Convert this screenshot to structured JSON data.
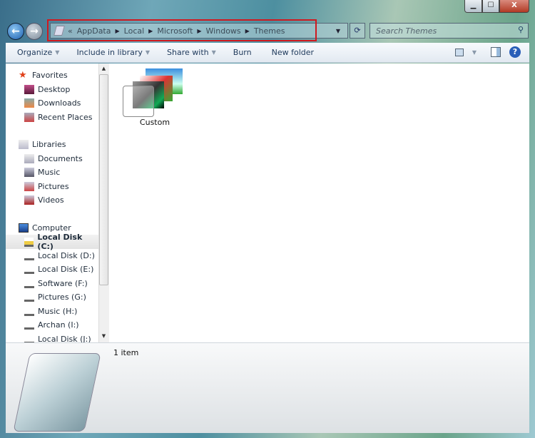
{
  "window": {
    "minimize": "▁",
    "maximize": "☐",
    "close": "X"
  },
  "nav": {
    "back": "←",
    "forward": "→"
  },
  "address": {
    "prefix": "«",
    "crumbs": [
      "AppData",
      "Local",
      "Microsoft",
      "Windows",
      "Themes"
    ]
  },
  "search": {
    "placeholder": "Search Themes",
    "icon": "search-icon"
  },
  "toolbar": {
    "organize": "Organize",
    "include": "Include in library",
    "share": "Share with",
    "burn": "Burn",
    "new_folder": "New folder",
    "help": "?"
  },
  "sidebar": {
    "favorites": {
      "label": "Favorites",
      "items": [
        "Desktop",
        "Downloads",
        "Recent Places"
      ]
    },
    "libraries": {
      "label": "Libraries",
      "items": [
        "Documents",
        "Music",
        "Pictures",
        "Videos"
      ]
    },
    "computer": {
      "label": "Computer",
      "items": [
        "Local Disk (C:)",
        "Local Disk (D:)",
        "Local Disk (E:)",
        "Software (F:)",
        "Pictures (G:)",
        "Music (H:)",
        "Archan (I:)",
        "Local Disk (J:)"
      ],
      "selected": "Local Disk (C:)"
    }
  },
  "content": {
    "items": [
      {
        "name": "Custom",
        "type": "theme-folder"
      }
    ]
  },
  "details": {
    "count": "1 item"
  },
  "colors": {
    "highlight_box": "#d0191f",
    "toolbar_text": "#1e395b"
  }
}
